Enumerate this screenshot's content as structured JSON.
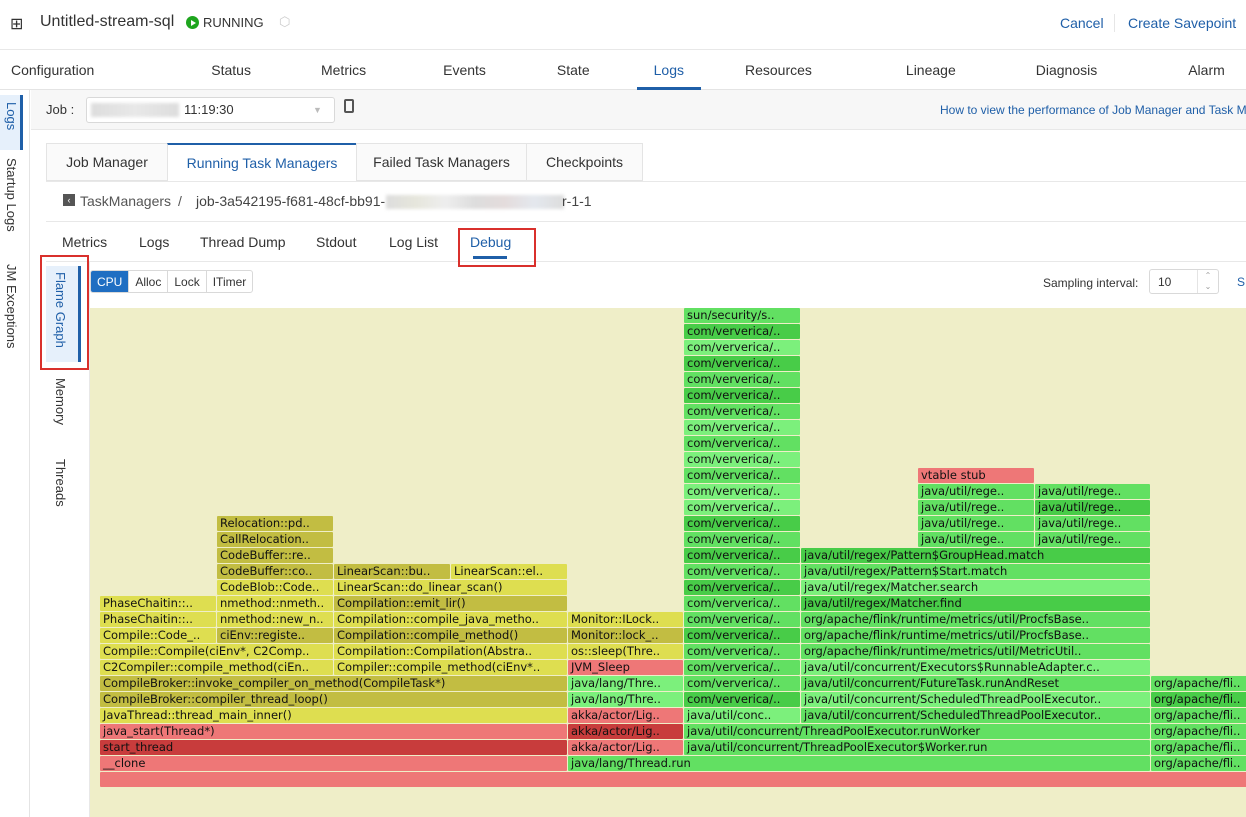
{
  "header": {
    "app_icon": "cluster-icon",
    "title": "Untitled-stream-sql",
    "status": "RUNNING",
    "status_color": "#1ea51e",
    "status_icon": "play-circle-icon",
    "extra_icon": "cube-icon",
    "cancel": "Cancel",
    "create_savepoint": "Create Savepoint"
  },
  "main_tabs": [
    "Configuration",
    "Status",
    "Metrics",
    "Events",
    "State",
    "Logs",
    "Resources",
    "Lineage",
    "Diagnosis",
    "Alarm"
  ],
  "active_main_tab": "Logs",
  "left_side": [
    "Logs",
    "Startup Logs",
    "JM Exceptions"
  ],
  "job": {
    "label": "Job :",
    "value": "11:19:30",
    "copy_icon": "copy-icon",
    "help_link": "How to view the performance of Job Manager and Task M"
  },
  "task_tabs": [
    "Job Manager",
    "Running Task Managers",
    "Failed Task Managers",
    "Checkpoints"
  ],
  "breadcrumb": {
    "back": "TaskManagers",
    "sep": "/",
    "job_id_prefix": "job-3a542195-f681-48cf-bb91-",
    "job_id_suffix": "r-1-1"
  },
  "sub_tabs": [
    "Metrics",
    "Logs",
    "Thread Dump",
    "Stdout",
    "Log List",
    "Debug"
  ],
  "inner_tabs": [
    "Flame Graph",
    "Memory",
    "Threads"
  ],
  "profile_modes": [
    "CPU",
    "Alloc",
    "Lock",
    "ITimer"
  ],
  "sampling": {
    "label": "Sampling interval:",
    "value": "10",
    "button": "S"
  },
  "colors": {
    "red": "#c83c3c",
    "pink": "#ee7777",
    "yellow": "#dede50",
    "olive": "#c2bd42",
    "green": "#62e062",
    "green-dark": "#48cc48",
    "green-light": "#7cf07c",
    "accent": "#1f5fa8"
  },
  "flame_frames": [
    {
      "label": "",
      "c": "pink"
    },
    {
      "label": "__clone",
      "c": "pink"
    },
    {
      "label": "java/lang/Thread.run",
      "c": "green"
    },
    {
      "label": "org/apache/fli..",
      "c": "green"
    },
    {
      "label": "start_thread",
      "c": "red"
    },
    {
      "label": "akka/actor/Lig..",
      "c": "pink"
    },
    {
      "label": "java/util/concurrent/ThreadPoolExecutor$Worker.run",
      "c": "green"
    },
    {
      "label": "org/apache/fli..",
      "c": "green"
    },
    {
      "label": "java_start(Thread*)",
      "c": "pink"
    },
    {
      "label": "akka/actor/Lig..",
      "c": "red"
    },
    {
      "label": "java/util/concurrent/ThreadPoolExecutor.runWorker",
      "c": "green"
    },
    {
      "label": "org/apache/fli..",
      "c": "green"
    },
    {
      "label": "JavaThread::thread_main_inner()",
      "c": "yellow"
    },
    {
      "label": "akka/actor/Lig..",
      "c": "pink"
    },
    {
      "label": "java/util/conc..",
      "c": "green-light"
    },
    {
      "label": "java/util/concurrent/ScheduledThreadPoolExecutor..",
      "c": "green"
    },
    {
      "label": "org/apache/fli..",
      "c": "green"
    },
    {
      "label": "CompileBroker::compiler_thread_loop()",
      "c": "olive"
    },
    {
      "label": "java/lang/Thre..",
      "c": "green-light"
    },
    {
      "label": "com/ververica/..",
      "c": "green-dark"
    },
    {
      "label": "java/util/concurrent/ScheduledThreadPoolExecutor..",
      "c": "green-light"
    },
    {
      "label": "org/apache/fli..",
      "c": "green-dark"
    },
    {
      "label": "CompileBroker::invoke_compiler_on_method(CompileTask*)",
      "c": "olive"
    },
    {
      "label": "java/lang/Thre..",
      "c": "green-light"
    },
    {
      "label": "com/ververica/..",
      "c": "green"
    },
    {
      "label": "java/util/concurrent/FutureTask.runAndReset",
      "c": "green"
    },
    {
      "label": "org/apache/fli..",
      "c": "green"
    },
    {
      "label": "C2Compiler::compile_method(ciEn..",
      "c": "yellow"
    },
    {
      "label": "Compiler::compile_method(ciEnv*..",
      "c": "yellow"
    },
    {
      "label": "JVM_Sleep",
      "c": "pink"
    },
    {
      "label": "com/ververica/..",
      "c": "green"
    },
    {
      "label": "java/util/concurrent/Executors$RunnableAdapter.c..",
      "c": "green-light"
    },
    {
      "label": "Compile::Compile(ciEnv*, C2Comp..",
      "c": "yellow"
    },
    {
      "label": "Compilation::Compilation(Abstra..",
      "c": "yellow"
    },
    {
      "label": "os::sleep(Thre..",
      "c": "yellow"
    },
    {
      "label": "com/ververica/..",
      "c": "green"
    },
    {
      "label": "org/apache/flink/runtime/metrics/util/MetricUtil..",
      "c": "green"
    },
    {
      "label": "Compile::Code_..",
      "c": "yellow"
    },
    {
      "label": "ciEnv::registe..",
      "c": "olive"
    },
    {
      "label": "Compilation::compile_method()",
      "c": "olive"
    },
    {
      "label": "Monitor::lock_..",
      "c": "olive"
    },
    {
      "label": "com/ververica/..",
      "c": "green-dark"
    },
    {
      "label": "org/apache/flink/runtime/metrics/util/ProcfsBase..",
      "c": "green"
    },
    {
      "label": "PhaseChaitin::..",
      "c": "yellow"
    },
    {
      "label": "nmethod::new_n..",
      "c": "yellow"
    },
    {
      "label": "Compilation::compile_java_metho..",
      "c": "yellow"
    },
    {
      "label": "Monitor::ILock..",
      "c": "yellow"
    },
    {
      "label": "com/ververica/..",
      "c": "green"
    },
    {
      "label": "org/apache/flink/runtime/metrics/util/ProcfsBase..",
      "c": "green"
    },
    {
      "label": "PhaseChaitin::..",
      "c": "yellow"
    },
    {
      "label": "nmethod::nmeth..",
      "c": "yellow"
    },
    {
      "label": "Compilation::emit_lir()",
      "c": "olive"
    },
    {
      "label": "com/ververica/..",
      "c": "green"
    },
    {
      "label": "java/util/regex/Matcher.find",
      "c": "green-dark"
    },
    {
      "label": "CodeBlob::Code..",
      "c": "yellow"
    },
    {
      "label": "LinearScan::do_linear_scan()",
      "c": "yellow"
    },
    {
      "label": "com/ververica/..",
      "c": "green-dark"
    },
    {
      "label": "java/util/regex/Matcher.search",
      "c": "green-light"
    },
    {
      "label": "CodeBuffer::co..",
      "c": "olive"
    },
    {
      "label": "LinearScan::bu..",
      "c": "olive"
    },
    {
      "label": "LinearScan::el..",
      "c": "yellow"
    },
    {
      "label": "com/ververica/..",
      "c": "green"
    },
    {
      "label": "java/util/regex/Pattern$Start.match",
      "c": "green"
    },
    {
      "label": "CodeBuffer::re..",
      "c": "olive"
    },
    {
      "label": "com/ververica/..",
      "c": "green-dark"
    },
    {
      "label": "java/util/regex/Pattern$GroupHead.match",
      "c": "green-dark"
    },
    {
      "label": "CallRelocation..",
      "c": "olive"
    },
    {
      "label": "com/ververica/..",
      "c": "green"
    },
    {
      "label": "java/util/rege..",
      "c": "green"
    },
    {
      "label": "java/util/rege..",
      "c": "green"
    },
    {
      "label": "Relocation::pd..",
      "c": "olive"
    },
    {
      "label": "com/ververica/..",
      "c": "green-dark"
    },
    {
      "label": "java/util/rege..",
      "c": "green"
    },
    {
      "label": "java/util/rege..",
      "c": "green"
    },
    {
      "label": "com/ververica/..",
      "c": "green-light"
    },
    {
      "label": "java/util/rege..",
      "c": "green"
    },
    {
      "label": "java/util/rege..",
      "c": "green-dark"
    },
    {
      "label": "com/ververica/..",
      "c": "green-light"
    },
    {
      "label": "java/util/rege..",
      "c": "green"
    },
    {
      "label": "java/util/rege..",
      "c": "green"
    },
    {
      "label": "vtable stub",
      "c": "pink"
    },
    {
      "label": "com/ververica/..",
      "c": "green"
    },
    {
      "label": "com/ververica/..",
      "c": "green-light"
    },
    {
      "label": "com/ververica/..",
      "c": "green"
    },
    {
      "label": "com/ververica/..",
      "c": "green-light"
    },
    {
      "label": "com/ververica/..",
      "c": "green"
    },
    {
      "label": "com/ververica/..",
      "c": "green-dark"
    },
    {
      "label": "com/ververica/..",
      "c": "green"
    },
    {
      "label": "com/ververica/..",
      "c": "green-dark"
    },
    {
      "label": "com/ververica/..",
      "c": "green-light"
    },
    {
      "label": "com/ververica/..",
      "c": "green-dark"
    },
    {
      "label": "sun/security/s..",
      "c": "green"
    },
    {
      "label": "",
      "c": "green"
    }
  ]
}
